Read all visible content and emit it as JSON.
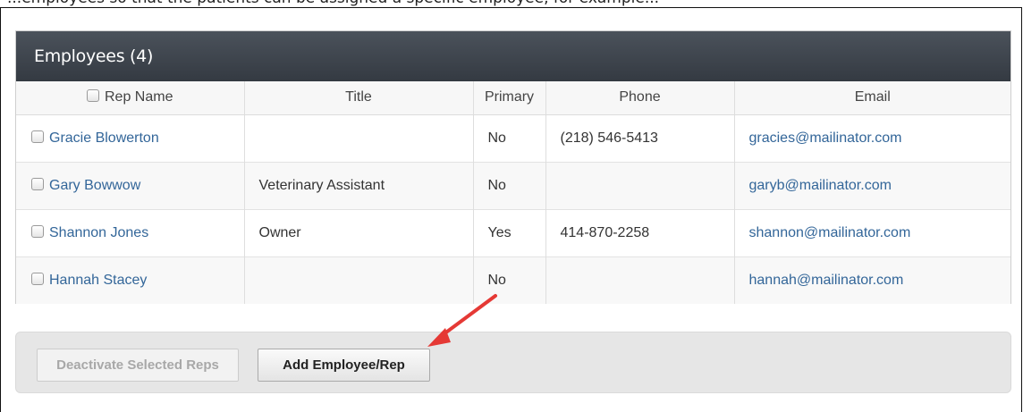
{
  "top_text": "...employees so that the patients can be assigned a specific employee, for example...",
  "panel": {
    "title": "Employees (4)"
  },
  "table": {
    "columns": {
      "rep_name": "Rep Name",
      "title": "Title",
      "primary": "Primary",
      "phone": "Phone",
      "email": "Email"
    },
    "rows": [
      {
        "name": "Gracie Blowerton",
        "title": "",
        "primary": "No",
        "phone": "(218) 546-5413",
        "email": "gracies@mailinator.com"
      },
      {
        "name": "Gary Bowwow",
        "title": "Veterinary Assistant",
        "primary": "No",
        "phone": "",
        "email": "garyb@mailinator.com"
      },
      {
        "name": "Shannon Jones",
        "title": "Owner",
        "primary": "Yes",
        "phone": "414-870-2258",
        "email": "shannon@mailinator.com"
      },
      {
        "name": "Hannah Stacey",
        "title": "",
        "primary": "No",
        "phone": "",
        "email": "hannah@mailinator.com"
      }
    ]
  },
  "actions": {
    "deactivate_label": "Deactivate Selected Reps",
    "add_label": "Add Employee/Rep"
  },
  "colors": {
    "header_bg": "#3d434b",
    "link": "#336699",
    "annotation_arrow": "#e53935"
  }
}
